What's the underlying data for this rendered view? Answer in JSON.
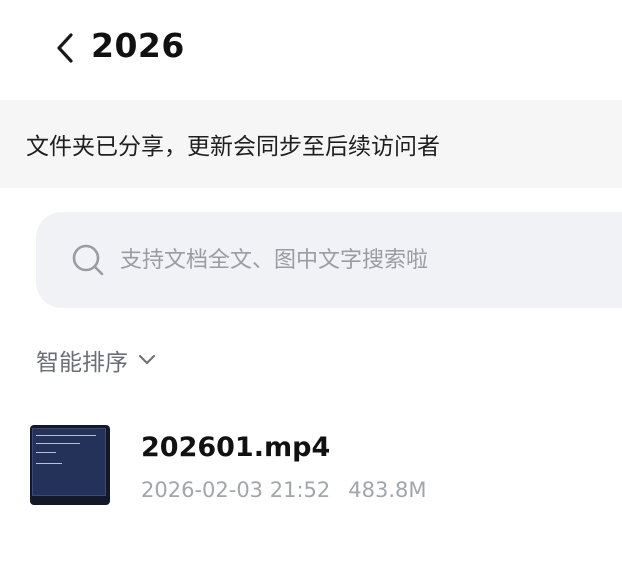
{
  "header": {
    "title": "2026",
    "back_icon": "chevron-left-icon"
  },
  "banner": {
    "text": "文件夹已分享，更新会同步至后续访问者"
  },
  "search": {
    "icon": "search-icon",
    "placeholder": "支持文档全文、图中文字搜索啦",
    "value": ""
  },
  "sort": {
    "label": "智能排序",
    "icon": "chevron-down-icon"
  },
  "files": [
    {
      "name": "202601.mp4",
      "date": "2026-02-03 21:52",
      "size": "483.8M",
      "thumbnail_icon": "video-thumbnail"
    }
  ],
  "colors": {
    "banner_bg": "#f6f6f7",
    "search_bg": "#f1f2f6",
    "muted_text": "#a3a5ad",
    "sort_text": "#6b6e77"
  }
}
